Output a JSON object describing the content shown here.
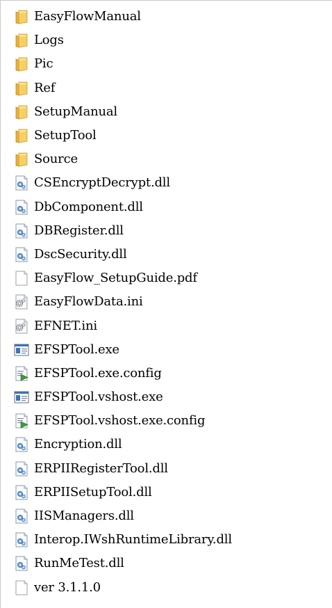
{
  "explorer": {
    "items": [
      {
        "name": "EasyFlowManual",
        "icon": "folder-icon",
        "type": "folder"
      },
      {
        "name": "Logs",
        "icon": "folder-icon",
        "type": "folder"
      },
      {
        "name": "Pic",
        "icon": "folder-icon",
        "type": "folder"
      },
      {
        "name": "Ref",
        "icon": "folder-icon",
        "type": "folder"
      },
      {
        "name": "SetupManual",
        "icon": "folder-icon",
        "type": "folder"
      },
      {
        "name": "SetupTool",
        "icon": "folder-icon",
        "type": "folder"
      },
      {
        "name": "Source",
        "icon": "folder-icon",
        "type": "folder"
      },
      {
        "name": "CSEncryptDecrypt.dll",
        "icon": "dll-file-icon",
        "type": "dll"
      },
      {
        "name": "DbComponent.dll",
        "icon": "dll-file-icon",
        "type": "dll"
      },
      {
        "name": "DBRegister.dll",
        "icon": "dll-file-icon",
        "type": "dll"
      },
      {
        "name": "DscSecurity.dll",
        "icon": "dll-file-icon",
        "type": "dll"
      },
      {
        "name": "EasyFlow_SetupGuide.pdf",
        "icon": "blank-file-icon",
        "type": "blank"
      },
      {
        "name": "EasyFlowData.ini",
        "icon": "ini-file-icon",
        "type": "ini"
      },
      {
        "name": "EFNET.ini",
        "icon": "ini-file-icon",
        "type": "ini"
      },
      {
        "name": "EFSPTool.exe",
        "icon": "exe-file-icon",
        "type": "exe"
      },
      {
        "name": "EFSPTool.exe.config",
        "icon": "config-file-icon",
        "type": "config"
      },
      {
        "name": "EFSPTool.vshost.exe",
        "icon": "exe-file-icon",
        "type": "exe"
      },
      {
        "name": "EFSPTool.vshost.exe.config",
        "icon": "config-file-icon",
        "type": "config"
      },
      {
        "name": "Encryption.dll",
        "icon": "dll-file-icon",
        "type": "dll"
      },
      {
        "name": "ERPIIRegisterTool.dll",
        "icon": "dll-file-icon",
        "type": "dll"
      },
      {
        "name": "ERPIISetupTool.dll",
        "icon": "dll-file-icon",
        "type": "dll"
      },
      {
        "name": "IISManagers.dll",
        "icon": "dll-file-icon",
        "type": "dll"
      },
      {
        "name": "Interop.IWshRuntimeLibrary.dll",
        "icon": "dll-file-icon",
        "type": "dll"
      },
      {
        "name": "RunMeTest.dll",
        "icon": "dll-file-icon",
        "type": "dll"
      },
      {
        "name": "ver 3.1.1.0",
        "icon": "blank-file-icon",
        "type": "blank"
      }
    ]
  }
}
